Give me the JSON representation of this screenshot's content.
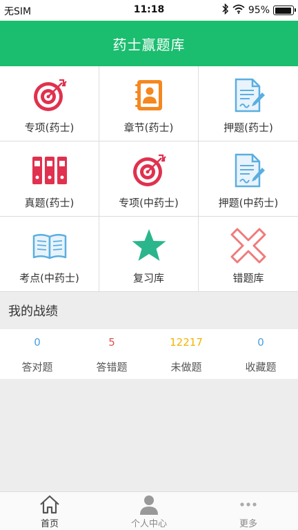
{
  "status": {
    "carrier": "无SIM",
    "time": "11:18",
    "battery_percent": "95%",
    "battery_level": 0.95
  },
  "header": {
    "title": "药士赢题库"
  },
  "grid": {
    "items": [
      {
        "label": "专项(药士)",
        "icon": "target-arrow-icon",
        "color": "#e0314f"
      },
      {
        "label": "章节(药士)",
        "icon": "address-book-icon",
        "color": "#f5871f"
      },
      {
        "label": "押题(药士)",
        "icon": "document-pen-icon",
        "color": "#5aaee0"
      },
      {
        "label": "真题(药士)",
        "icon": "binders-icon",
        "color": "#e0314f"
      },
      {
        "label": "专项(中药士)",
        "icon": "target-arrow-icon",
        "color": "#e0314f"
      },
      {
        "label": "押题(中药士)",
        "icon": "document-pen-icon",
        "color": "#5aaee0"
      },
      {
        "label": "考点(中药士)",
        "icon": "open-book-icon",
        "color": "#5aaee0"
      },
      {
        "label": "复习库",
        "icon": "star-icon",
        "color": "#2bb58c"
      },
      {
        "label": "错题库",
        "icon": "cross-icon",
        "color": "#f07a7a"
      }
    ]
  },
  "record": {
    "title": "我的战绩",
    "stats": [
      {
        "value": "0",
        "label": "答对题",
        "color": "#4a9fd8"
      },
      {
        "value": "5",
        "label": "答错题",
        "color": "#e05050"
      },
      {
        "value": "12217",
        "label": "未做题",
        "color": "#f0b400"
      },
      {
        "value": "0",
        "label": "收藏题",
        "color": "#4a9fd8"
      }
    ]
  },
  "tabbar": {
    "tabs": [
      {
        "label": "首页",
        "icon": "home-icon"
      },
      {
        "label": "个人中心",
        "icon": "user-icon"
      },
      {
        "label": "更多",
        "icon": "more-dots-icon"
      }
    ]
  }
}
